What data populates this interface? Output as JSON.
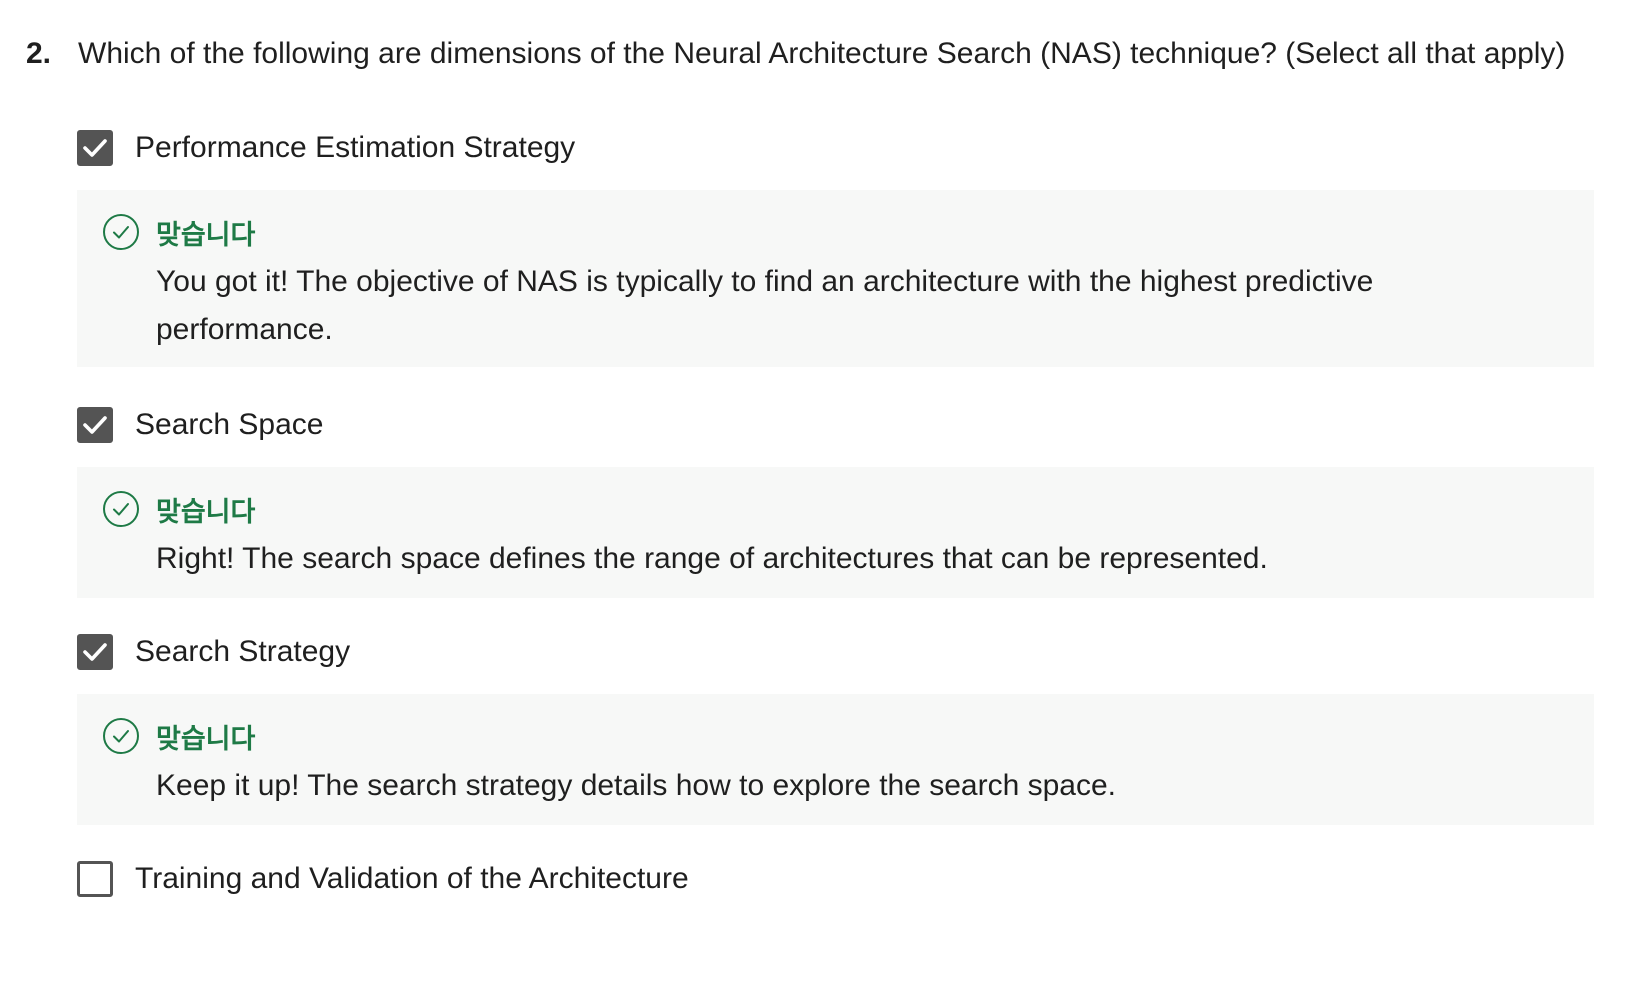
{
  "question": {
    "number": "2.",
    "text": "Which of the following are dimensions of the Neural Architecture Search (NAS) technique? (Select all that apply)"
  },
  "options": [
    {
      "label": "Performance Estimation Strategy",
      "checked": true,
      "feedback": {
        "title": "맞습니다",
        "text": "You got it! The objective of NAS is typically to find an architecture with the highest predictive performance."
      }
    },
    {
      "label": "Search Space",
      "checked": true,
      "feedback": {
        "title": "맞습니다",
        "text": "Right! The search space defines the range of architectures that can be represented."
      }
    },
    {
      "label": "Search Strategy",
      "checked": true,
      "feedback": {
        "title": "맞습니다",
        "text": "Keep it up! The search strategy details how to explore the search space."
      }
    },
    {
      "label": "Training and Validation of the Architecture",
      "checked": false
    }
  ],
  "colors": {
    "correct": "#1e7a46",
    "checkbox": "#545454",
    "feedback_bg": "#f7f8f7"
  },
  "icons": {
    "checkmark": "checkmark-icon",
    "correct": "check-circle-icon"
  }
}
